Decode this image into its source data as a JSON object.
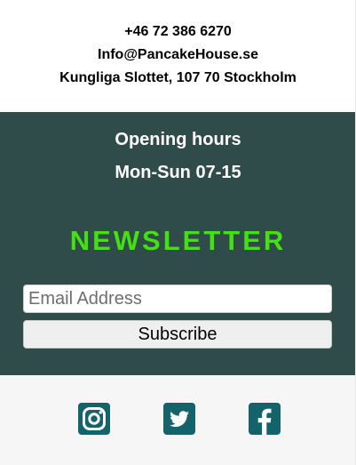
{
  "contact": {
    "phone": "+46 72 386 6270",
    "email": "Info@PancakeHouse.se",
    "address": "Kungliga Slottet, 107 70 Stockholm"
  },
  "hours": {
    "title": "Opening hours",
    "time": "Mon-Sun 07-15"
  },
  "newsletter": {
    "title": "NEWSLETTER",
    "email_placeholder": "Email Address",
    "email_value": "",
    "subscribe_label": "Subscribe"
  },
  "social": {
    "icons": [
      "instagram-icon",
      "twitter-icon",
      "facebook-icon"
    ]
  },
  "colors": {
    "dark_section": "#2f4c4a",
    "newsletter_title": "#43e012",
    "social_icon_bg": "#14636a",
    "footer_bg": "#f6f6f6"
  }
}
